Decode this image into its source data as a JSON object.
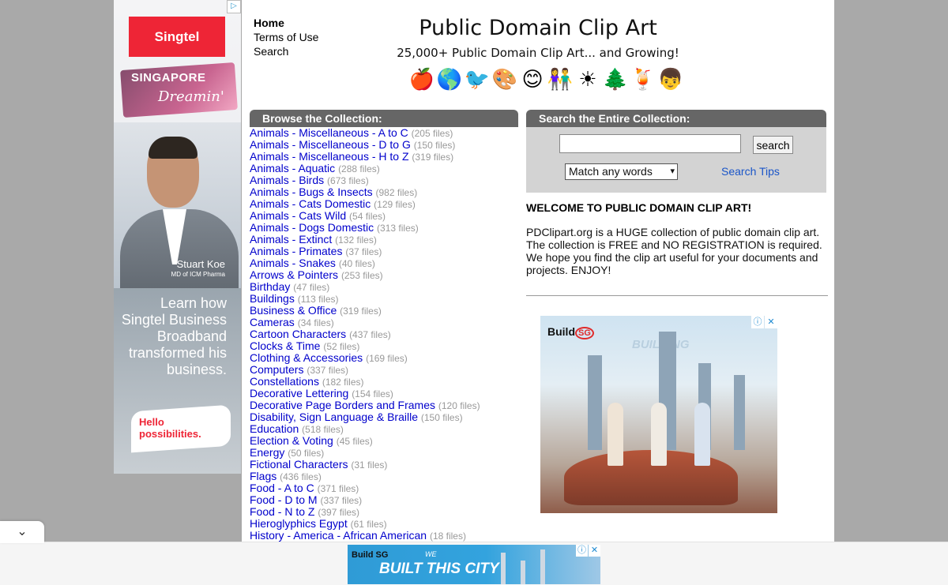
{
  "left_ad": {
    "adchoice_glyph": "▷",
    "brand": "Singtel",
    "campaign_line1": "SINGAPORE",
    "campaign_line2": "Dreamin'",
    "person_name": "Stuart Koe",
    "person_role": "MD of ICM Pharma",
    "pitch": "Learn how Singtel Business Broadband transformed his business.",
    "cta": "Hello possibilities."
  },
  "nav": {
    "home": "Home",
    "terms": "Terms of Use",
    "search": "Search"
  },
  "header": {
    "title": "Public Domain Clip Art",
    "tagline": "25,000+ Public Domain Clip Art... and Growing!",
    "clip_icons": [
      {
        "name": "apple-icon",
        "glyph": "🍎"
      },
      {
        "name": "globe-icon",
        "glyph": "🌎"
      },
      {
        "name": "bird-icon",
        "glyph": "🐦"
      },
      {
        "name": "palette-icon",
        "glyph": "🎨"
      },
      {
        "name": "smiley-icon",
        "glyph": "😊"
      },
      {
        "name": "cartoon-people-icon",
        "glyph": "👫"
      },
      {
        "name": "sun-icon",
        "glyph": "☀"
      },
      {
        "name": "tree-icon",
        "glyph": "🌲"
      },
      {
        "name": "blender-icon",
        "glyph": "🍹"
      },
      {
        "name": "person-icon",
        "glyph": "👦"
      }
    ]
  },
  "browse": {
    "header": "Browse the Collection:",
    "items": [
      {
        "label": "Animals - Miscellaneous - A to C",
        "count": "(205 files)"
      },
      {
        "label": "Animals - Miscellaneous - D to G",
        "count": "(150 files)"
      },
      {
        "label": "Animals - Miscellaneous - H to Z",
        "count": "(319 files)"
      },
      {
        "label": "Animals - Aquatic",
        "count": "(288 files)"
      },
      {
        "label": "Animals - Birds",
        "count": "(673 files)"
      },
      {
        "label": "Animals - Bugs & Insects",
        "count": "(982 files)"
      },
      {
        "label": "Animals - Cats Domestic",
        "count": "(129 files)"
      },
      {
        "label": "Animals - Cats Wild",
        "count": "(54 files)"
      },
      {
        "label": "Animals - Dogs Domestic",
        "count": "(313 files)"
      },
      {
        "label": "Animals - Extinct",
        "count": "(132 files)"
      },
      {
        "label": "Animals - Primates",
        "count": "(37 files)"
      },
      {
        "label": "Animals - Snakes",
        "count": "(40 files)"
      },
      {
        "label": "Arrows & Pointers",
        "count": "(253 files)"
      },
      {
        "label": "Birthday",
        "count": "(47 files)"
      },
      {
        "label": "Buildings",
        "count": "(113 files)"
      },
      {
        "label": "Business & Office",
        "count": "(319 files)"
      },
      {
        "label": "Cameras",
        "count": "(34 files)"
      },
      {
        "label": "Cartoon Characters",
        "count": "(437 files)"
      },
      {
        "label": "Clocks & Time",
        "count": "(52 files)"
      },
      {
        "label": "Clothing & Accessories",
        "count": "(169 files)"
      },
      {
        "label": "Computers",
        "count": "(337 files)"
      },
      {
        "label": "Constellations",
        "count": "(182 files)"
      },
      {
        "label": "Decorative Lettering",
        "count": "(154 files)"
      },
      {
        "label": "Decorative Page Borders and Frames",
        "count": "(120 files)"
      },
      {
        "label": "Disability, Sign Language & Braille",
        "count": "(150 files)"
      },
      {
        "label": "Education",
        "count": "(518 files)"
      },
      {
        "label": "Election & Voting",
        "count": "(45 files)"
      },
      {
        "label": "Energy",
        "count": "(50 files)"
      },
      {
        "label": "Fictional Characters",
        "count": "(31 files)"
      },
      {
        "label": "Flags",
        "count": "(436 files)"
      },
      {
        "label": "Food - A to C",
        "count": "(371 files)"
      },
      {
        "label": "Food - D to M",
        "count": "(337 files)"
      },
      {
        "label": "Food - N to Z",
        "count": "(397 files)"
      },
      {
        "label": "Hieroglyphics Egypt",
        "count": "(61 files)"
      },
      {
        "label": "History - America - African American",
        "count": "(18 files)"
      }
    ]
  },
  "search": {
    "header": "Search the Entire Collection:",
    "input_value": "",
    "button_label": "search",
    "match_selected": "Match any words",
    "tips_label": "Search Tips"
  },
  "welcome": {
    "title": "WELCOME TO PUBLIC DOMAIN CLIP ART!",
    "body": "PDClipart.org is a HUGE collection of public domain clip art. The collection is FREE and NO REGISTRATION is required. We hope you find the clip art useful for your documents and projects. ENJOY!"
  },
  "right_ad": {
    "brand": "Build",
    "brand_badge": "SG",
    "headline": "BUILDING",
    "info_glyph": "ⓘ",
    "close_glyph": "✕"
  },
  "bottom_ad": {
    "brand": "Build SG",
    "kicker": "WE",
    "headline": "BUILT THIS CITY",
    "info_glyph": "ⓘ",
    "close_glyph": "✕"
  },
  "collapse_glyph": "⌄"
}
